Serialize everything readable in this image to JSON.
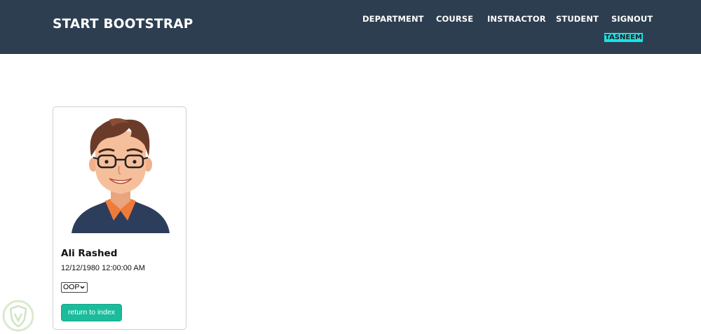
{
  "navbar": {
    "brand": "START BOOTSTRAP",
    "links": [
      "DEPARTMENT",
      "COURSE",
      "INSTRACTOR",
      "STUDENT",
      "SIGNOUT"
    ],
    "user": "TASNEEM",
    "background": "#2c3e50",
    "user_highlight": "#1ce1e8"
  },
  "card": {
    "avatar_icon": "student-avatar-illustration",
    "name": "Ali Rashed",
    "date": "12/12/1980 12:00:00 AM",
    "course_selected": "OOP",
    "return_label": "return to index",
    "button_color": "#1abc9c"
  },
  "watermark_icon": "shield-logo"
}
